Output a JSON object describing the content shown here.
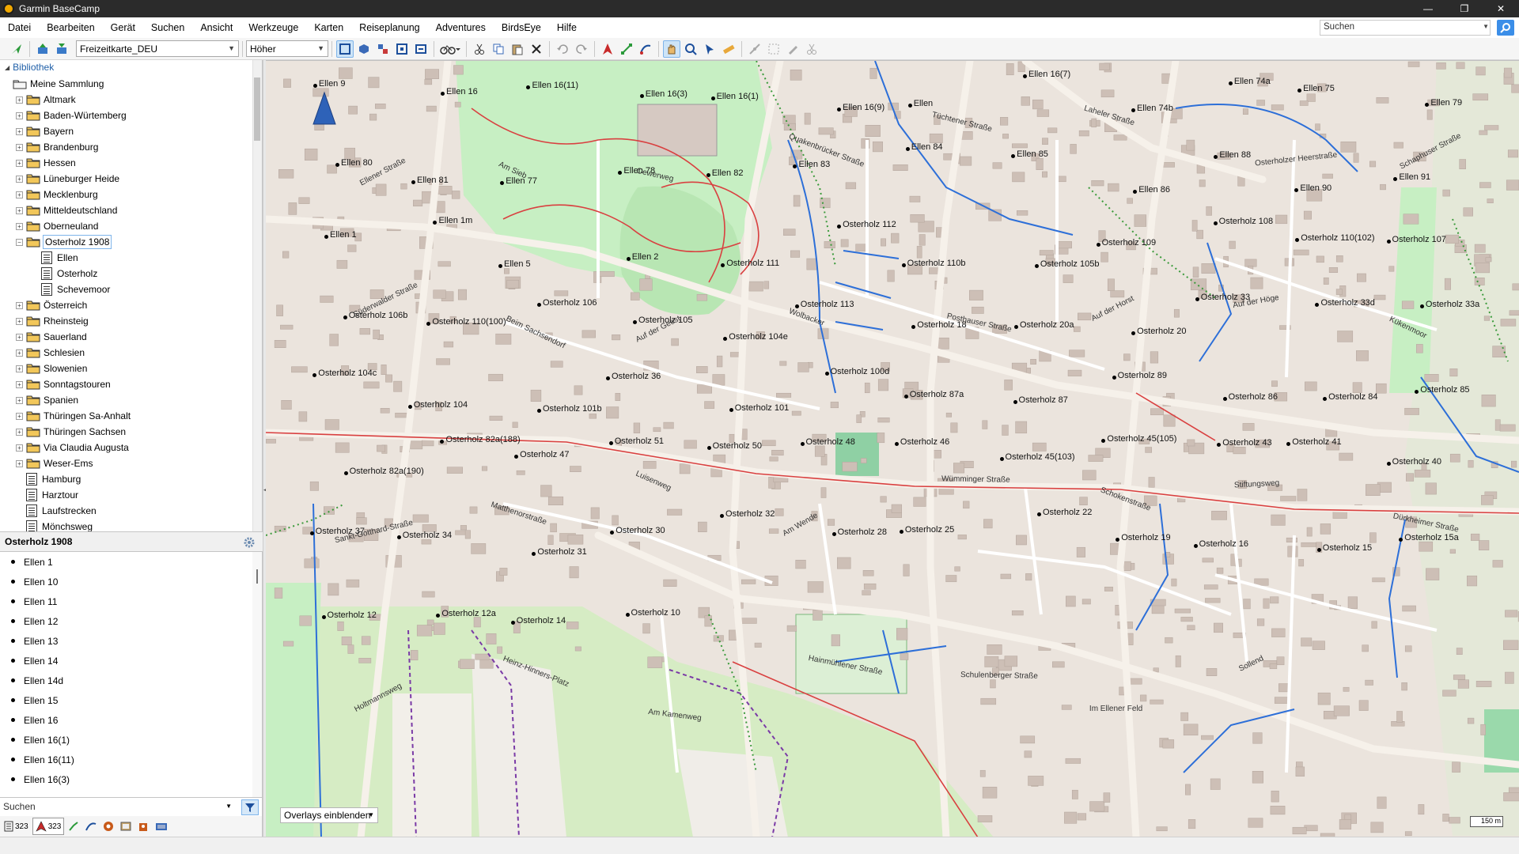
{
  "window": {
    "title": "Garmin BaseCamp",
    "min_glyph": "—",
    "max_glyph": "❐",
    "close_glyph": "✕"
  },
  "menu": [
    "Datei",
    "Bearbeiten",
    "Gerät",
    "Suchen",
    "Ansicht",
    "Werkzeuge",
    "Karten",
    "Reiseplanung",
    "Adventures",
    "BirdsEye",
    "Hilfe"
  ],
  "global_search": {
    "placeholder": "Suchen"
  },
  "toolbar": {
    "map_product": "Freizeitkarte_DEU",
    "detail_level": "Höher"
  },
  "library": {
    "header": "Bibliothek",
    "root": "Meine Sammlung",
    "items": [
      {
        "label": "Altmark",
        "type": "folder"
      },
      {
        "label": "Baden-Würtemberg",
        "type": "folder"
      },
      {
        "label": "Bayern",
        "type": "folder"
      },
      {
        "label": "Brandenburg",
        "type": "folder"
      },
      {
        "label": "Hessen",
        "type": "folder"
      },
      {
        "label": "Lüneburger Heide",
        "type": "folder"
      },
      {
        "label": "Mecklenburg",
        "type": "folder"
      },
      {
        "label": "Mitteldeutschland",
        "type": "folder"
      },
      {
        "label": "Oberneuland",
        "type": "folder"
      },
      {
        "label": "Osterholz 1908",
        "type": "folder-open",
        "selected": true
      },
      {
        "label": "Ellen",
        "type": "list",
        "child": true
      },
      {
        "label": "Osterholz",
        "type": "list",
        "child": true
      },
      {
        "label": "Schevemoor",
        "type": "list",
        "child": true
      },
      {
        "label": "Österreich",
        "type": "folder"
      },
      {
        "label": "Rheinsteig",
        "type": "folder"
      },
      {
        "label": "Sauerland",
        "type": "folder"
      },
      {
        "label": "Schlesien",
        "type": "folder"
      },
      {
        "label": "Slowenien",
        "type": "folder"
      },
      {
        "label": "Sonntagstouren",
        "type": "folder"
      },
      {
        "label": "Spanien",
        "type": "folder"
      },
      {
        "label": "Thüringen Sa-Anhalt",
        "type": "folder"
      },
      {
        "label": "Thüringen Sachsen",
        "type": "folder"
      },
      {
        "label": "Via Claudia Augusta",
        "type": "folder"
      },
      {
        "label": "Weser-Ems",
        "type": "folder"
      },
      {
        "label": "Hamburg",
        "type": "list"
      },
      {
        "label": "Harztour",
        "type": "list"
      },
      {
        "label": "Laufstrecken",
        "type": "list"
      },
      {
        "label": "Mönchsweg",
        "type": "list"
      }
    ]
  },
  "collection": {
    "title": "Osterholz 1908",
    "items": [
      "Ellen 1",
      "Ellen 10",
      "Ellen 11",
      "Ellen 12",
      "Ellen 13",
      "Ellen 14",
      "Ellen 14d",
      "Ellen 15",
      "Ellen 16",
      "Ellen 16(1)",
      "Ellen 16(11)",
      "Ellen 16(3)"
    ]
  },
  "bottom": {
    "search_placeholder": "Suchen",
    "tabs": [
      {
        "count": "323",
        "icon": "list-icon"
      },
      {
        "count": "323",
        "icon": "waypoint-icon",
        "active": true
      }
    ]
  },
  "map": {
    "overlays_label": "Overlays einblenden",
    "scale_label": "150 m",
    "street_labels": [
      "Ellener Straße",
      "Am Sieb",
      "Oewerweg",
      "Quakenbrücker Straße",
      "Tüchtener Straße",
      "Laheler Straße",
      "Osterholzer Heerstraße",
      "Schaphuser Straße",
      "Süderwalder Straße",
      "Beim Sachsendorf",
      "Auf der Geest",
      "Wolbacker",
      "Posthauser Straße",
      "Auf der Horst",
      "Auf der Höge",
      "Kükenmoor",
      "Sankt-Gotthard-Straße",
      "Matthenorstraße",
      "Luisenweg",
      "Am Wende",
      "Wümminger Straße",
      "Schokenstraße",
      "Stiftungsweg",
      "Dürkheimer Straße",
      "Holtmannsweg",
      "Heinz-Hinners-Platz",
      "Am Kamenweg",
      "Hainmühlener Straße",
      "Schulenberger Straße",
      "Im Ellener Feld",
      "Sollend"
    ],
    "waypoints": [
      "Ellen 9",
      "Ellen 16",
      "Ellen 16(11)",
      "Ellen 16(3)",
      "Ellen 16(1)",
      "Ellen 16(9)",
      "Ellen",
      "Ellen 16(7)",
      "Ellen 74b",
      "Ellen 74a",
      "Ellen 75",
      "Ellen 79",
      "Ellen 80",
      "Ellen 81",
      "Ellen 77",
      "Ellen 78",
      "Ellen 82",
      "Ellen 83",
      "Ellen 84",
      "Ellen 85",
      "Ellen 86",
      "Ellen 88",
      "Ellen 90",
      "Ellen 91",
      "Ellen 1",
      "Ellen 1m",
      "Ellen 5",
      "Ellen 2",
      "Osterholz 111",
      "Osterholz 112",
      "Osterholz 110b",
      "Osterholz 105b",
      "Osterholz 109",
      "Osterholz 108",
      "Osterholz 110(102)",
      "Osterholz 107",
      "Osterholz 106b",
      "Osterholz 110(100)",
      "Osterholz 106",
      "Osterholz 105",
      "Osterholz 104e",
      "Osterholz 113",
      "Osterholz 18",
      "Osterholz 20a",
      "Osterholz 20",
      "Osterholz 33",
      "Osterholz 33d",
      "Osterholz 33a",
      "Osterholz 104c",
      "Osterholz 104",
      "Osterholz 101b",
      "Osterholz 36",
      "Osterholz 101",
      "Osterholz 100d",
      "Osterholz 87a",
      "Osterholz 87",
      "Osterholz 89",
      "Osterholz 86",
      "Osterholz 84",
      "Osterholz 85",
      "Osterholz 82a(190)",
      "Osterholz 82a(188)",
      "Osterholz 47",
      "Osterholz 51",
      "Osterholz 50",
      "Osterholz 48",
      "Osterholz 46",
      "Osterholz 45(103)",
      "Osterholz 45(105)",
      "Osterholz 43",
      "Osterholz 41",
      "Osterholz 40",
      "Osterholz 37",
      "Osterholz 34",
      "Osterholz 31",
      "Osterholz 30",
      "Osterholz 32",
      "Osterholz 28",
      "Osterholz 25",
      "Osterholz 22",
      "Osterholz 19",
      "Osterholz 16",
      "Osterholz 15",
      "Osterholz 15a",
      "Osterholz 12",
      "Osterholz 12a",
      "Osterholz 14",
      "Osterholz 10"
    ]
  }
}
